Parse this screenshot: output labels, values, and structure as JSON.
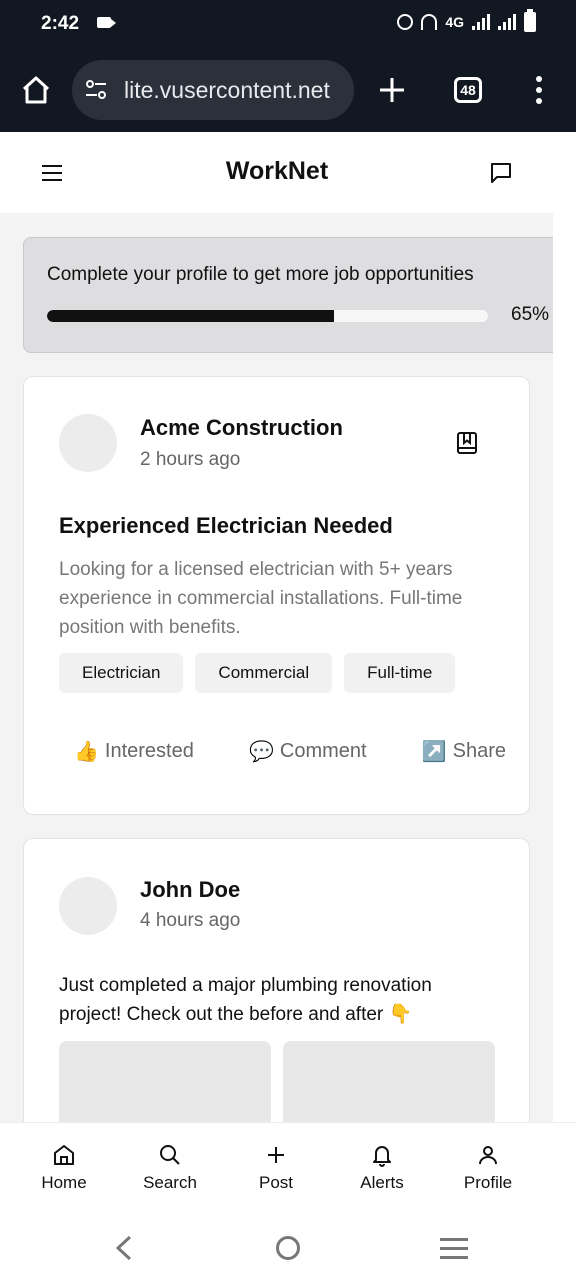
{
  "status_bar": {
    "time": "2:42",
    "network": "4G"
  },
  "browser": {
    "url": "lite.vusercontent.net",
    "tab_count": "48"
  },
  "app": {
    "title": "WorkNet"
  },
  "profile_banner": {
    "text": "Complete your profile to get more job opportunities",
    "percent_label": "65%",
    "progress": 0.65
  },
  "posts": [
    {
      "author": "Acme Construction",
      "time": "2 hours ago",
      "title": "Experienced Electrician Needed",
      "description": "Looking for a licensed electrician with 5+ years experience in commercial installations. Full-time position with benefits.",
      "tags": [
        "Electrician",
        "Commercial",
        "Full-time"
      ],
      "actions": [
        {
          "icon": "👍",
          "label": "Interested"
        },
        {
          "icon": "💬",
          "label": "Comment"
        },
        {
          "icon": "↗️",
          "label": "Share"
        }
      ]
    },
    {
      "author": "John Doe",
      "time": "4 hours ago",
      "text": "Just completed a major plumbing renovation project! Check out the before and after 👇"
    }
  ],
  "bottom_nav": [
    {
      "icon": "home-icon",
      "label": "Home"
    },
    {
      "icon": "search-icon",
      "label": "Search"
    },
    {
      "icon": "plus-icon",
      "label": "Post"
    },
    {
      "icon": "bell-icon",
      "label": "Alerts"
    },
    {
      "icon": "user-icon",
      "label": "Profile"
    }
  ]
}
